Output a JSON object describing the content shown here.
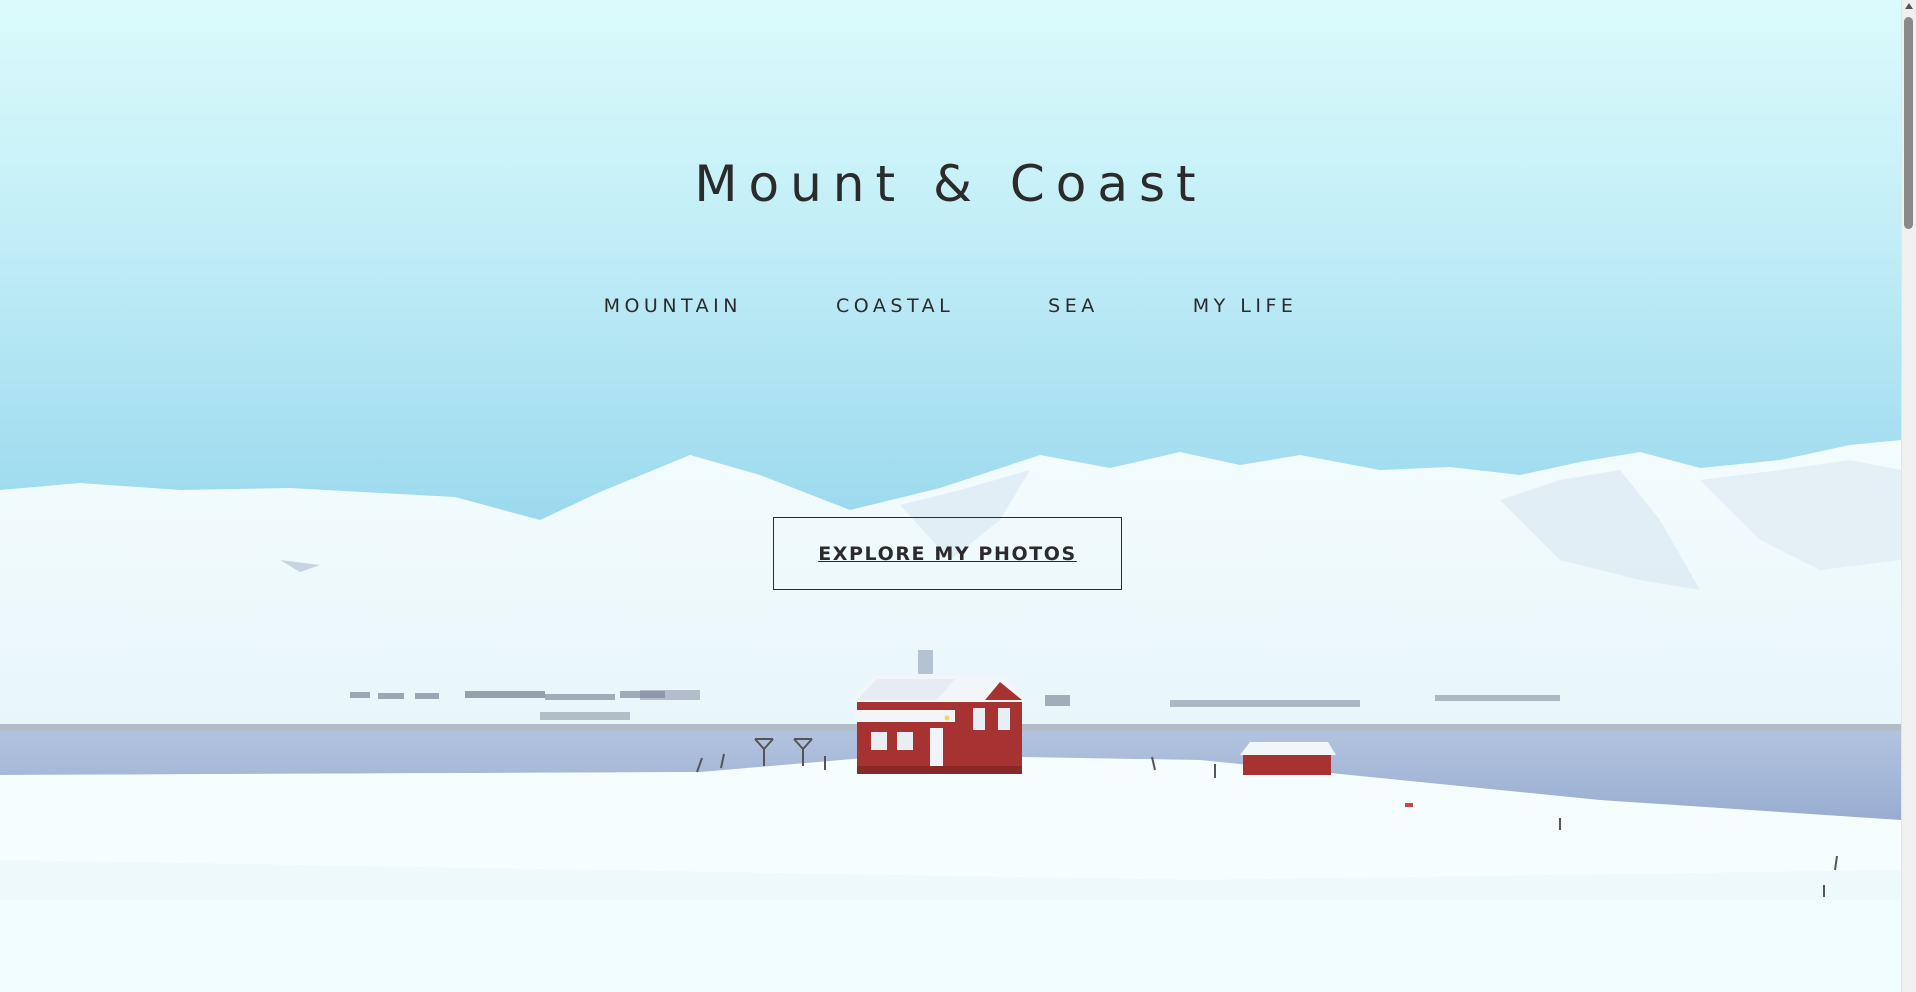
{
  "site": {
    "title": "Mount & Coast"
  },
  "nav": {
    "items": [
      {
        "label": "MOUNTAIN"
      },
      {
        "label": "COASTAL"
      },
      {
        "label": "SEA"
      },
      {
        "label": "MY LIFE"
      }
    ]
  },
  "hero": {
    "cta_label": "EXPLORE MY PHOTOS",
    "image_subject": "snowy-mountains-red-house-landscape"
  },
  "colors": {
    "text": "#2b2b2b",
    "sky_top": "#dafbfb",
    "sky_bottom": "#9fdbf0",
    "water": "#a7b9d6",
    "house_red": "#a63232"
  }
}
